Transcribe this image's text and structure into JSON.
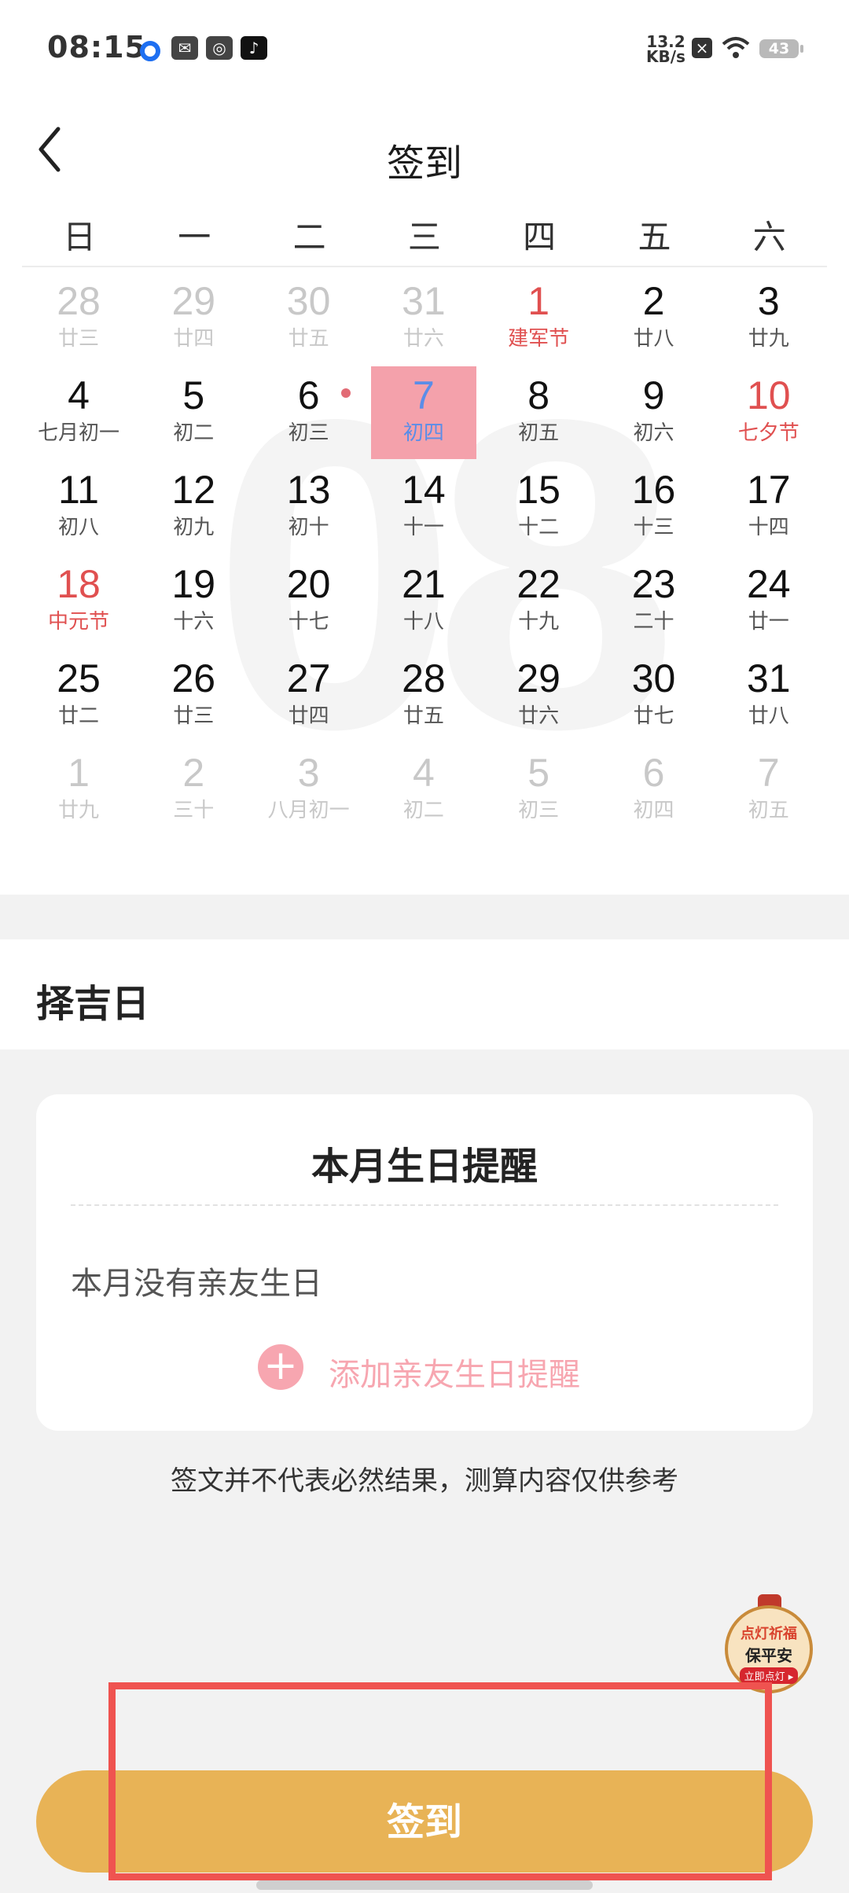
{
  "status_bar": {
    "time": "08:15",
    "net_speed_value": "13.2",
    "net_speed_unit": "KB/s",
    "battery": "43"
  },
  "header": {
    "title": "签到"
  },
  "calendar": {
    "watermark_month": "08",
    "weekdays": [
      "日",
      "一",
      "二",
      "三",
      "四",
      "五",
      "六"
    ],
    "days": [
      {
        "n": "28",
        "l": "廿三",
        "s": "other"
      },
      {
        "n": "29",
        "l": "廿四",
        "s": "other"
      },
      {
        "n": "30",
        "l": "廿五",
        "s": "other"
      },
      {
        "n": "31",
        "l": "廿六",
        "s": "other"
      },
      {
        "n": "1",
        "l": "建军节",
        "s": "red"
      },
      {
        "n": "2",
        "l": "廿八",
        "s": ""
      },
      {
        "n": "3",
        "l": "廿九",
        "s": ""
      },
      {
        "n": "4",
        "l": "七月初一",
        "s": ""
      },
      {
        "n": "5",
        "l": "初二",
        "s": ""
      },
      {
        "n": "6",
        "l": "初三",
        "s": ""
      },
      {
        "n": "7",
        "l": "初四",
        "s": "today"
      },
      {
        "n": "8",
        "l": "初五",
        "s": ""
      },
      {
        "n": "9",
        "l": "初六",
        "s": ""
      },
      {
        "n": "10",
        "l": "七夕节",
        "s": "red"
      },
      {
        "n": "11",
        "l": "初八",
        "s": ""
      },
      {
        "n": "12",
        "l": "初九",
        "s": ""
      },
      {
        "n": "13",
        "l": "初十",
        "s": ""
      },
      {
        "n": "14",
        "l": "十一",
        "s": ""
      },
      {
        "n": "15",
        "l": "十二",
        "s": ""
      },
      {
        "n": "16",
        "l": "十三",
        "s": ""
      },
      {
        "n": "17",
        "l": "十四",
        "s": ""
      },
      {
        "n": "18",
        "l": "中元节",
        "s": "red"
      },
      {
        "n": "19",
        "l": "十六",
        "s": ""
      },
      {
        "n": "20",
        "l": "十七",
        "s": ""
      },
      {
        "n": "21",
        "l": "十八",
        "s": ""
      },
      {
        "n": "22",
        "l": "十九",
        "s": ""
      },
      {
        "n": "23",
        "l": "二十",
        "s": ""
      },
      {
        "n": "24",
        "l": "廿一",
        "s": ""
      },
      {
        "n": "25",
        "l": "廿二",
        "s": ""
      },
      {
        "n": "26",
        "l": "廿三",
        "s": ""
      },
      {
        "n": "27",
        "l": "廿四",
        "s": ""
      },
      {
        "n": "28",
        "l": "廿五",
        "s": ""
      },
      {
        "n": "29",
        "l": "廿六",
        "s": ""
      },
      {
        "n": "30",
        "l": "廿七",
        "s": ""
      },
      {
        "n": "31",
        "l": "廿八",
        "s": ""
      },
      {
        "n": "1",
        "l": "廿九",
        "s": "other"
      },
      {
        "n": "2",
        "l": "三十",
        "s": "other"
      },
      {
        "n": "3",
        "l": "八月初一",
        "s": "other"
      },
      {
        "n": "4",
        "l": "初二",
        "s": "other"
      },
      {
        "n": "5",
        "l": "初三",
        "s": "other"
      },
      {
        "n": "6",
        "l": "初四",
        "s": "other"
      },
      {
        "n": "7",
        "l": "初五",
        "s": "other"
      }
    ]
  },
  "choose_day": {
    "title": "择吉日"
  },
  "birthday_card": {
    "title": "本月生日提醒",
    "empty_text": "本月没有亲友生日",
    "add_label": "添加亲友生日提醒"
  },
  "disclaimer": "签文并不代表必然结果，测算内容仅供参考",
  "lamp_widget": {
    "line1": "点灯祈福",
    "line2": "保平安",
    "cta": "立即点灯 ▸"
  },
  "checkin_button": {
    "label": "签到"
  },
  "colors": {
    "accent": "#e8b356",
    "festival_red": "#e05050",
    "today_bg": "#f4a1ab",
    "pink": "#f7a6b0",
    "highlight": "#ef5350"
  },
  "icons": [
    "back-arrow-icon",
    "plus-icon",
    "wifi-icon",
    "lamp-icon"
  ]
}
